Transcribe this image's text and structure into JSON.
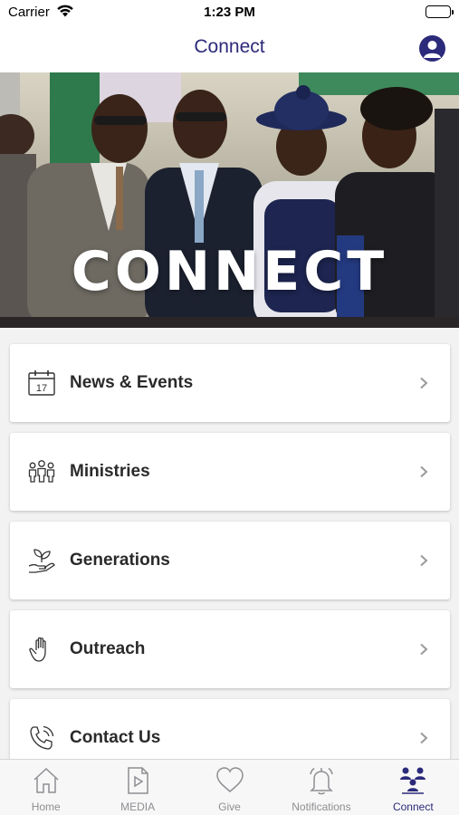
{
  "status_bar": {
    "carrier": "Carrier",
    "time": "1:23 PM"
  },
  "nav": {
    "title": "Connect"
  },
  "hero": {
    "title": "CONNECT"
  },
  "menu": [
    {
      "label": "News & Events",
      "icon": "calendar-icon",
      "calendar_day": "17"
    },
    {
      "label": "Ministries",
      "icon": "people-group-icon"
    },
    {
      "label": "Generations",
      "icon": "plant-in-hand-icon"
    },
    {
      "label": "Outreach",
      "icon": "hand-icon"
    },
    {
      "label": "Contact Us",
      "icon": "phone-icon"
    }
  ],
  "tabs": [
    {
      "label": "Home",
      "icon": "home-icon",
      "active": false
    },
    {
      "label": "MEDIA",
      "icon": "media-play-icon",
      "active": false
    },
    {
      "label": "Give",
      "icon": "heart-icon",
      "active": false
    },
    {
      "label": "Notifications",
      "icon": "bell-icon",
      "active": false
    },
    {
      "label": "Connect",
      "icon": "people-connect-icon",
      "active": true
    }
  ],
  "colors": {
    "accent": "#2c2a7a",
    "tab_inactive": "#8e8e93",
    "background": "#f2f2f2"
  }
}
